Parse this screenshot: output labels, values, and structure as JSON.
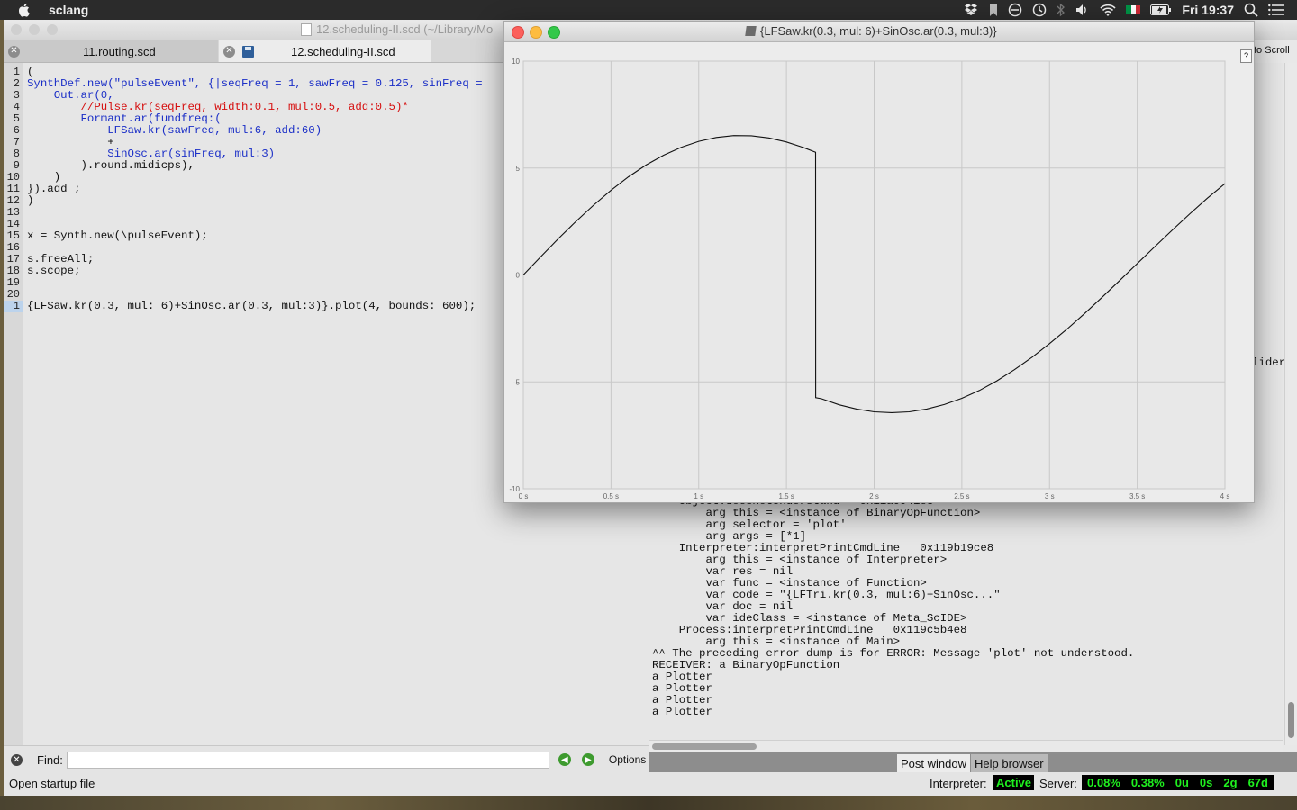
{
  "menubar": {
    "app_name": "sclang",
    "clock": "Fri 19:37",
    "icons": [
      "apple-icon",
      "dropbox-icon",
      "bookmark-icon",
      "sync-icon",
      "time-machine-icon",
      "bluetooth-icon",
      "volume-icon",
      "wifi-icon",
      "flag-italy-icon",
      "battery-icon",
      "spotlight-icon",
      "notification-icon"
    ],
    "flag_colors": [
      "#009246",
      "#ffffff",
      "#ce2b37"
    ]
  },
  "ide": {
    "window_title": "12.scheduling-II.scd (~/Library/Mo",
    "tabs": [
      {
        "label": "11.routing.scd",
        "active": false
      },
      {
        "label": "12.scheduling-II.scd",
        "active": true
      }
    ]
  },
  "editor": {
    "line_numbers": [
      "1",
      "2",
      "3",
      "4",
      "5",
      "6",
      "7",
      "8",
      "9",
      "10",
      "11",
      "12",
      "13",
      "14",
      "15",
      "16",
      "17",
      "18",
      "19",
      "20",
      "1"
    ],
    "lines": [
      "(",
      "SynthDef.new(\"pulseEvent\", {|seqFreq = 1, sawFreq = 0.125, sinFreq =",
      "    Out.ar(0,",
      "        //Pulse.kr(seqFreq, width:0.1, mul:0.5, add:0.5)*",
      "        Formant.ar(fundfreq:(",
      "            LFSaw.kr(sawFreq, mul:6, add:60)",
      "            +",
      "            SinOsc.ar(sinFreq, mul:3)",
      "        ).round.midicps),",
      "    )",
      "}).add ;",
      ")",
      "",
      "",
      "x = Synth.new(\\pulseEvent);",
      "",
      "s.freeAll;",
      "s.scope;",
      "",
      "",
      "{LFSaw.kr(0.3, mul: 6)+SinOsc.ar(0.3, mul:3)}.plot(4, bounds: 600);"
    ]
  },
  "post": {
    "autoscroll_label": "to Scroll",
    "slider_fragment": "lider",
    "lines": [
      "    Object:doesNotUnderstand   0x11a0941e8",
      "        arg this = <instance of BinaryOpFunction>",
      "        arg selector = 'plot'",
      "        arg args = [*1]",
      "    Interpreter:interpretPrintCmdLine   0x119b19ce8",
      "        arg this = <instance of Interpreter>",
      "        var res = nil",
      "        var func = <instance of Function>",
      "        var code = \"{LFTri.kr(0.3, mul:6)+SinOsc...\"",
      "        var doc = nil",
      "        var ideClass = <instance of Meta_ScIDE>",
      "    Process:interpretPrintCmdLine   0x119c5b4e8",
      "        arg this = <instance of Main>",
      "^^ The preceding error dump is for ERROR: Message 'plot' not understood.",
      "RECEIVER: a BinaryOpFunction",
      "a Plotter",
      "a Plotter",
      "a Plotter",
      "a Plotter"
    ]
  },
  "findbar": {
    "label": "Find:",
    "value": "",
    "placeholder": "",
    "options_label": "Options"
  },
  "dock_tabs": [
    "Post window",
    "Help browser"
  ],
  "status": {
    "startup_label": "Open startup file",
    "interpreter_label": "Interpreter:",
    "interpreter_state": "Active",
    "server_label": "Server:",
    "server_stats": [
      "0.08%",
      "0.38%",
      "0u",
      "0s",
      "2g",
      "67d"
    ]
  },
  "plot_window": {
    "title": "{LFSaw.kr(0.3, mul: 6)+SinOsc.ar(0.3, mul:3)}",
    "help_label": "?"
  },
  "chart_data": {
    "type": "line",
    "title": "",
    "xlabel": "",
    "ylabel": "",
    "xlim": [
      0,
      4
    ],
    "ylim": [
      -10,
      10
    ],
    "grid": true,
    "x_ticks": [
      "0 s",
      "0.5 s",
      "1 s",
      "1.5 s",
      "2 s",
      "2.5 s",
      "3 s",
      "3.5 s",
      "4 s"
    ],
    "x_tick_values": [
      0,
      0.5,
      1,
      1.5,
      2,
      2.5,
      3,
      3.5,
      4
    ],
    "y_ticks": [
      "10",
      "5",
      "0",
      "-5",
      "-10"
    ],
    "y_tick_values": [
      10,
      5,
      0,
      -5,
      -10
    ],
    "series": [
      {
        "x": [
          0,
          0.1,
          0.2,
          0.3,
          0.4,
          0.5,
          0.6,
          0.7,
          0.8,
          0.9,
          1.0,
          1.1,
          1.2,
          1.3,
          1.4,
          1.5,
          1.6,
          1.666,
          1.667,
          1.7,
          1.8,
          1.9,
          2.0,
          2.1,
          2.2,
          2.3,
          2.4,
          2.5,
          2.6,
          2.7,
          2.8,
          2.9,
          3.0,
          3.1,
          3.2,
          3.3,
          3.4,
          3.5,
          3.6,
          3.7,
          3.8,
          3.9,
          4.0
        ],
        "y": [
          0,
          0.86,
          1.7,
          2.5,
          3.26,
          3.96,
          4.59,
          5.14,
          5.6,
          5.97,
          6.25,
          6.43,
          6.52,
          6.51,
          6.41,
          6.22,
          5.95,
          5.74,
          -5.74,
          -5.79,
          -6.07,
          -6.27,
          -6.4,
          -6.44,
          -6.4,
          -6.27,
          -6.06,
          -5.77,
          -5.4,
          -4.95,
          -4.43,
          -3.85,
          -3.21,
          -2.53,
          -1.8,
          -1.04,
          -0.26,
          0.53,
          1.32,
          2.1,
          2.86,
          3.59,
          4.27
        ]
      }
    ]
  }
}
